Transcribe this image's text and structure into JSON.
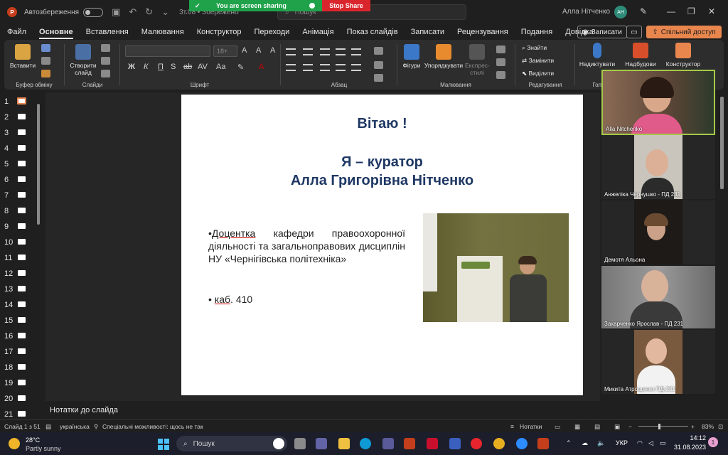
{
  "titlebar": {
    "autosave_label": "Автозбереження",
    "doc_title": "3т.08 • Збережено",
    "search_placeholder": "Пошук",
    "user_name": "Алла Нітченко",
    "user_initials": "АН"
  },
  "sharing": {
    "text": "You are screen sharing",
    "stop_label": "Stop Share"
  },
  "menu": {
    "tabs": [
      "Файл",
      "Основне",
      "Вставлення",
      "Малювання",
      "Конструктор",
      "Переходи",
      "Анімація",
      "Показ слайдів",
      "Записати",
      "Рецензування",
      "Подання",
      "Довідка"
    ],
    "active_tab": "Основне",
    "record_label": "Записати",
    "share_label": "Спільний доступ"
  },
  "ribbon": {
    "paste_label": "Вставити",
    "clipboard_group": "Буфер обміну",
    "new_slide_label": "Створити слайд",
    "slides_group": "Слайди",
    "font_size_placeholder": "18+",
    "font_group": "Шрифт",
    "paragraph_group": "Абзац",
    "shapes_label": "Фігури",
    "arrange_label": "Упорядкувати",
    "styles_label": "Експрес-стилі",
    "drawing_group": "Малювання",
    "find_label": "Знайти",
    "replace_label": "Замінити",
    "select_label": "Виділити",
    "editing_group": "Редагування",
    "dictate_label": "Надиктувати",
    "voice_group": "Голос",
    "addins_label": "Надбудови",
    "designer_label": "Конструктор",
    "format_buttons": [
      "Ж",
      "К",
      "П",
      "S",
      "ab",
      "AV",
      "Aa"
    ]
  },
  "thumbnails": {
    "numbers": [
      "1",
      "2",
      "3",
      "4",
      "5",
      "6",
      "7",
      "8",
      "9",
      "10",
      "11",
      "12",
      "13",
      "14",
      "15",
      "16",
      "17",
      "18",
      "19",
      "20",
      "21"
    ],
    "active": "1"
  },
  "slide": {
    "title": "Вітаю !",
    "subtitle_line1": "Я – куратор",
    "subtitle_line2": "Алла Григорівна Нітченко",
    "bullet1_prefix": "•",
    "bullet1_word": "Доцентка",
    "bullet1_rest": " кафедри правоохоронної діяльності та загальноправових дисциплін НУ «Чернігівська політехніка»",
    "bullet2_prefix": "•",
    "bullet2_word": "каб",
    "bullet2_rest": ". 410"
  },
  "notes": {
    "label": "Нотатки до слайда"
  },
  "statusbar": {
    "slide_info": "Слайд 1 з 51",
    "language": "українська",
    "accessibility": "Спеціальні можливості: щось не так",
    "notes_button": "Нотатки",
    "zoom": "83%"
  },
  "participants": [
    {
      "name": "Alla Nitchenko"
    },
    {
      "name": "Анжеліка Чернушко - ПД 231"
    },
    {
      "name": "Демотя Альона"
    },
    {
      "name": "Захарченко Ярослав - ПД 231"
    },
    {
      "name": "Микита Атрощенко ПД-231"
    }
  ],
  "taskbar": {
    "temperature": "28°C",
    "condition": "Partly sunny",
    "search_placeholder": "Пошук",
    "language": "УКР",
    "time": "14:12",
    "date": "31.08.2023",
    "notification_count": "1"
  },
  "colors": {
    "accent": "#e8864e",
    "share_green": "#1fa24a",
    "share_red": "#d9262c",
    "slide_title": "#1f3864"
  }
}
